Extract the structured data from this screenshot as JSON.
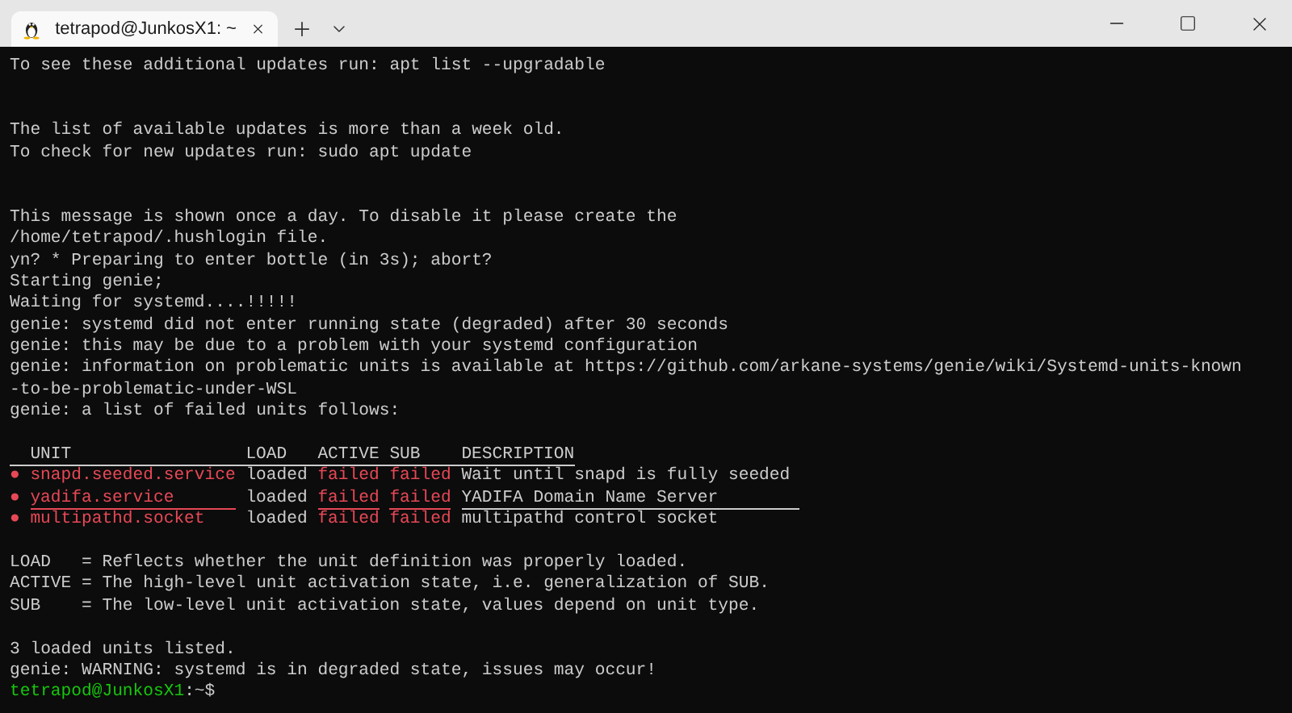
{
  "tab": {
    "title": "tetrapod@JunkosX1: ~",
    "selected": true
  },
  "terminal": [
    {
      "kind": "text",
      "text": "To see these additional updates run: apt list --upgradable"
    },
    {
      "kind": "blank"
    },
    {
      "kind": "blank"
    },
    {
      "kind": "text",
      "text": "The list of available updates is more than a week old."
    },
    {
      "kind": "text",
      "text": "To check for new updates run: sudo apt update"
    },
    {
      "kind": "blank"
    },
    {
      "kind": "blank"
    },
    {
      "kind": "text",
      "text": "This message is shown once a day. To disable it please create the"
    },
    {
      "kind": "text",
      "text": "/home/tetrapod/.hushlogin file."
    },
    {
      "kind": "text",
      "text": "yn? * Preparing to enter bottle (in 3s); abort?"
    },
    {
      "kind": "text",
      "text": "Starting genie;"
    },
    {
      "kind": "text",
      "text": "Waiting for systemd....!!!!!"
    },
    {
      "kind": "text",
      "text": "genie: systemd did not enter running state (degraded) after 30 seconds"
    },
    {
      "kind": "text",
      "text": "genie: this may be due to a problem with your systemd configuration"
    },
    {
      "kind": "text",
      "text": "genie: information on problematic units is available at https://github.com/arkane-systems/genie/wiki/Systemd-units-known"
    },
    {
      "kind": "text",
      "text": "-to-be-problematic-under-WSL"
    },
    {
      "kind": "text",
      "text": "genie: a list of failed units follows:"
    },
    {
      "kind": "blank"
    },
    {
      "kind": "table",
      "columns": [
        "UNIT",
        "LOAD",
        "ACTIVE",
        "SUB",
        "DESCRIPTION"
      ],
      "rows": [
        {
          "marker": "●",
          "unit": "snapd.seeded.service",
          "load": "loaded",
          "active": "failed",
          "sub": "failed",
          "description": "Wait until snapd is fully seeded",
          "underlined": false
        },
        {
          "marker": "●",
          "unit": "yadifa.service",
          "load": "loaded",
          "active": "failed",
          "sub": "failed",
          "description": "YADIFA Domain Name Server",
          "underlined": true
        },
        {
          "marker": "●",
          "unit": "multipathd.socket",
          "load": "loaded",
          "active": "failed",
          "sub": "failed",
          "description": "multipathd control socket",
          "underlined": false
        }
      ]
    },
    {
      "kind": "blank"
    },
    {
      "kind": "text",
      "text": "LOAD   = Reflects whether the unit definition was properly loaded."
    },
    {
      "kind": "text",
      "text": "ACTIVE = The high-level unit activation state, i.e. generalization of SUB."
    },
    {
      "kind": "text",
      "text": "SUB    = The low-level unit activation state, values depend on unit type."
    },
    {
      "kind": "blank"
    },
    {
      "kind": "text",
      "text": "3 loaded units listed."
    },
    {
      "kind": "text",
      "text": "genie: WARNING: systemd is in degraded state, issues may occur!"
    },
    {
      "kind": "prompt",
      "user": "tetrapod@JunkosX1",
      "path": ":~$"
    }
  ]
}
